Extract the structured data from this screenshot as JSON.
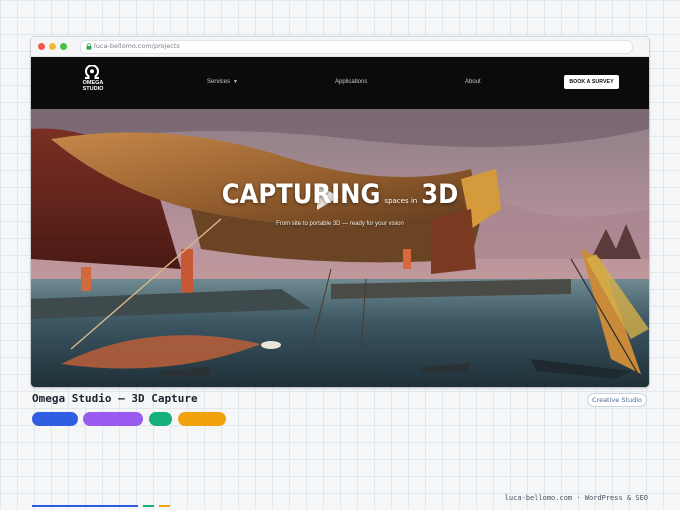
{
  "browser": {
    "url": "luca-bellomo.com/projects"
  },
  "site": {
    "logo": {
      "line1": "OMEGA",
      "line2": "STUDIO"
    },
    "nav": {
      "services": "Services",
      "applications": "Applications",
      "about": "About",
      "cta": "BOOK A SURVEY"
    },
    "hero": {
      "headline_main": "CAPTURING",
      "headline_small": "spaces in",
      "headline_end": "3D",
      "subline": "From site to portable 3D — ready for your vision"
    }
  },
  "project": {
    "title": "Omega Studio — 3D Capture",
    "tag": "Creative Studio",
    "swatches": [
      {
        "name": "blue",
        "color": "#2f5fe0"
      },
      {
        "name": "purple",
        "color": "#9a5af0"
      },
      {
        "name": "green",
        "color": "#14b07c"
      },
      {
        "name": "amber",
        "color": "#f2a20f"
      }
    ]
  },
  "footer": {
    "credit": "luca-bellomo.com · WordPress & SEO"
  }
}
